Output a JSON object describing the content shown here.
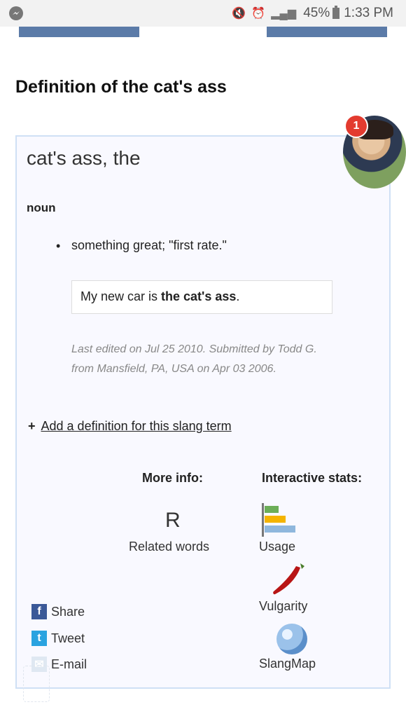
{
  "status_bar": {
    "battery": "45%",
    "time": "1:33 PM"
  },
  "page": {
    "title": "Definition of the cat's ass"
  },
  "avatar": {
    "notification_count": "1"
  },
  "definition": {
    "term": "cat's ass, the",
    "part_of_speech": "noun",
    "meaning": "something great; \"first rate.\"",
    "example_prefix": "My new car is ",
    "example_bold": "the cat's ass",
    "example_suffix": ".",
    "meta_line1": "Last edited on Jul 25 2010. Submitted by Todd G.",
    "meta_line2": "from Mansfield, PA, USA on Apr 03 2006."
  },
  "actions": {
    "add_definition": "Add a definition for this slang term"
  },
  "more_info": {
    "heading": "More info:",
    "related_icon_letter": "R",
    "related_label": "Related words"
  },
  "interactive_stats": {
    "heading": "Interactive stats:",
    "usage_label": "Usage",
    "vulgarity_label": "Vulgarity",
    "slangmap_label": "SlangMap"
  },
  "share": {
    "share_label": "Share",
    "tweet_label": "Tweet",
    "email_label": "E-mail"
  },
  "colors": {
    "top_bar": "#5b7ba8",
    "card_border": "#cfe0f5",
    "badge": "#e33b2f"
  },
  "icons": {
    "messenger": "messenger-icon",
    "facebook": "facebook-icon",
    "twitter": "twitter-icon",
    "email": "email-icon",
    "usage": "bar-chart-icon",
    "vulgarity": "chili-pepper-icon",
    "slangmap": "globe-icon"
  }
}
